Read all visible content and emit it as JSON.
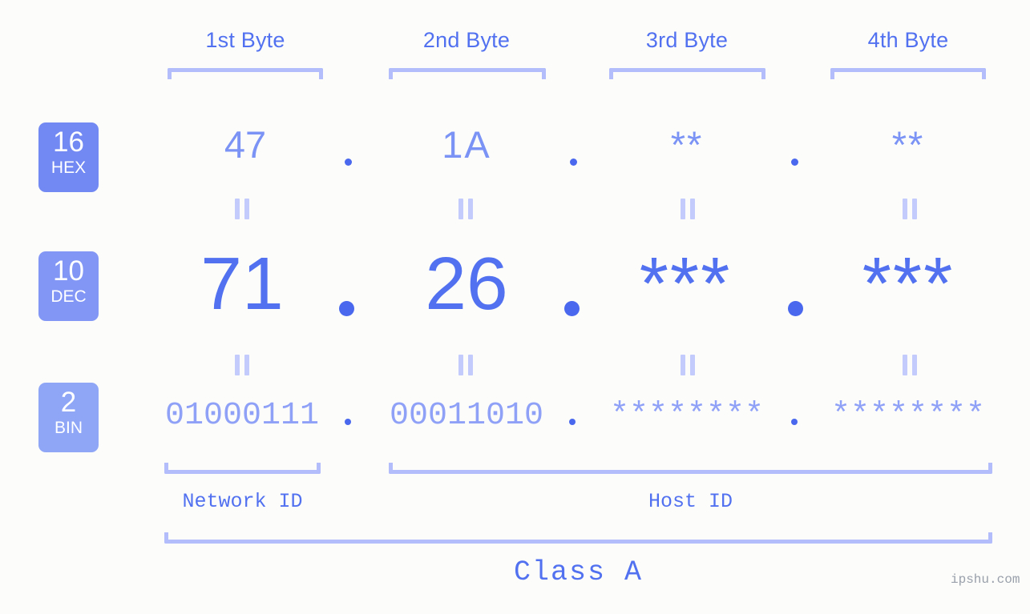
{
  "page": {
    "background": "#fcfdfa",
    "accent": "#5271f0",
    "accent_light": "#b3bdfb",
    "watermark": "ipshu.com"
  },
  "byte_headers": [
    {
      "label": "1st Byte"
    },
    {
      "label": "2nd Byte"
    },
    {
      "label": "3rd Byte"
    },
    {
      "label": "4th Byte"
    }
  ],
  "bases": [
    {
      "number": "16",
      "name": "HEX",
      "color": "#7288f2"
    },
    {
      "number": "10",
      "name": "DEC",
      "color": "#8296f5"
    },
    {
      "number": "2",
      "name": "BIN",
      "color": "#8fa6f7"
    }
  ],
  "rows": {
    "hex": {
      "values": [
        "47",
        "1A",
        "**",
        "**"
      ],
      "separator": "."
    },
    "dec": {
      "values": [
        "71",
        "26",
        "***",
        "***"
      ],
      "separator": "."
    },
    "bin": {
      "values": [
        "01000111",
        "00011010",
        "********",
        "********"
      ],
      "separator": "."
    }
  },
  "equals_symbol": "=",
  "segments": {
    "network_id": "Network ID",
    "host_id": "Host ID"
  },
  "class": {
    "label": "Class A"
  }
}
